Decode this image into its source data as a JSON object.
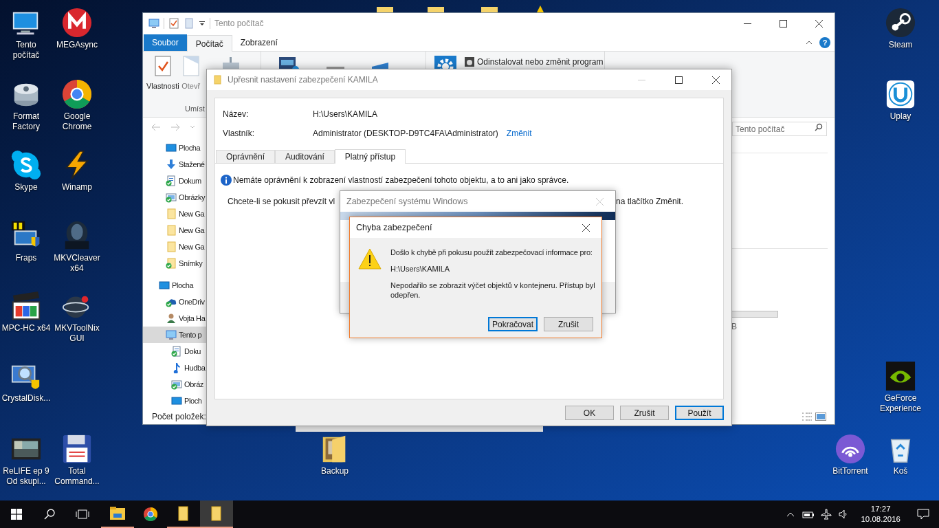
{
  "desktop": {
    "shortcuts": [
      {
        "kind": "computer",
        "lines": [
          "Tento",
          "počítač"
        ]
      },
      {
        "kind": "mega",
        "lines": [
          "MEGAsync"
        ]
      },
      {
        "kind": "format",
        "lines": [
          "Format",
          "Factory"
        ]
      },
      {
        "kind": "chrome",
        "lines": [
          "Google",
          "Chrome"
        ]
      },
      {
        "kind": "skype",
        "lines": [
          "Skype"
        ]
      },
      {
        "kind": "winamp",
        "lines": [
          "Winamp"
        ]
      },
      {
        "kind": "fraps",
        "lines": [
          "Fraps"
        ]
      },
      {
        "kind": "mkvcleaver",
        "lines": [
          "MKVCleaver",
          "x64"
        ]
      },
      {
        "kind": "mpc",
        "lines": [
          "MPC-HC x64"
        ]
      },
      {
        "kind": "mkvtoolnix",
        "lines": [
          "MKVToolNix",
          "GUI"
        ]
      },
      {
        "kind": "crystal",
        "lines": [
          "CrystalDisk..."
        ]
      },
      {
        "kind": "video",
        "lines": [
          "ReLIFE ep 9",
          "Od skupi..."
        ]
      },
      {
        "kind": "totalcmd",
        "lines": [
          "Total",
          "Command..."
        ]
      },
      {
        "kind": "folder_picture",
        "lines": [
          "Backup"
        ]
      },
      {
        "kind": "steam",
        "lines": [
          "Steam"
        ]
      },
      {
        "kind": "uplay",
        "lines": [
          "Uplay"
        ]
      },
      {
        "kind": "geforce",
        "lines": [
          "GeForce",
          "Experience"
        ]
      },
      {
        "kind": "bittorrent",
        "lines": [
          "BitTorrent"
        ]
      },
      {
        "kind": "bin",
        "lines": [
          "Koš"
        ]
      }
    ]
  },
  "explorer": {
    "title": "Tento počítač",
    "tabs": [
      {
        "label": "Soubor",
        "kind": "file",
        "selected": false
      },
      {
        "label": "Počítač",
        "kind": "tab",
        "selected": true
      },
      {
        "label": "Zobrazení",
        "kind": "tab",
        "selected": false
      }
    ],
    "help": "?",
    "ribbon": {
      "items": [
        {
          "label": "Vlastnosti",
          "disabled": false
        },
        {
          "label": "Otevř",
          "disabled": true
        }
      ],
      "group_label": "Umíst",
      "uninstall": "Odinstalovat nebo změnit program"
    },
    "search": {
      "placeholder": "Tento počítač"
    },
    "quick_access": [
      {
        "label": "Plocha",
        "kind": "desktop",
        "synced": false
      },
      {
        "label": "Stažené",
        "kind": "download",
        "synced": false
      },
      {
        "label": "Dokum",
        "kind": "document",
        "synced": true
      },
      {
        "label": "Obrázky",
        "kind": "pictures",
        "synced": true
      },
      {
        "label": "New Ga",
        "kind": "folder",
        "synced": false
      },
      {
        "label": "New Ga",
        "kind": "folder",
        "synced": false
      },
      {
        "label": "New Ga",
        "kind": "folder",
        "synced": false
      },
      {
        "label": "Snímky",
        "kind": "folder",
        "synced": true
      }
    ],
    "tree": [
      {
        "label": "Plocha",
        "kind": "desktop",
        "synced": false,
        "selected": false,
        "children": [
          {
            "label": "OneDriv",
            "kind": "cloud",
            "synced": true,
            "selected": false
          },
          {
            "label": "Vojta Ha",
            "kind": "user",
            "synced": false,
            "selected": false
          },
          {
            "label": "Tento p",
            "kind": "computer",
            "synced": false,
            "selected": true,
            "children": [
              {
                "label": "Doku",
                "kind": "document",
                "synced": true,
                "selected": false
              },
              {
                "label": "Hudba",
                "kind": "music",
                "synced": false,
                "selected": false
              },
              {
                "label": "Obráz",
                "kind": "pictures",
                "synced": true,
                "selected": false
              },
              {
                "label": "Ploch",
                "kind": "desktop",
                "synced": false,
                "selected": false
              }
            ]
          }
        ]
      }
    ],
    "drive_size": "B",
    "status_bar": "Počet položek:"
  },
  "security_dialog": {
    "title": "Upřesnit nastavení zabezpečení KAMILA",
    "fields": [
      {
        "label": "Název:",
        "value": "H:\\Users\\KAMILA"
      },
      {
        "label": "Vlastník:",
        "value": "Administrator (DESKTOP-D9TC4FA\\Administrator)",
        "link": "Změnit"
      }
    ],
    "tabs": [
      {
        "label": "Oprávnění",
        "selected": false
      },
      {
        "label": "Auditování",
        "selected": false
      },
      {
        "label": "Platný přístup",
        "selected": true
      }
    ],
    "info": "Nemáte oprávnění k zobrazení vlastností zabezpečení tohoto objektu, a to ani jako správce.",
    "hint_left": "Chcete-li se pokusit převzít vl",
    "hint_right": "na tlačítko Změnit.",
    "buttons": [
      {
        "label": "OK",
        "default": false
      },
      {
        "label": "Zrušit",
        "default": false
      },
      {
        "label": "Použít",
        "default": true
      }
    ]
  },
  "windows_security": {
    "title": "Zabezpečení systému Windows"
  },
  "error_dialog": {
    "title": "Chyba zabezpečení",
    "message": "Došlo k chybě při pokusu použít zabezpečovací informace pro:",
    "path": "H:\\Users\\KAMILA",
    "detail": "Nepodařilo se zobrazit výčet objektů v kontejneru. Přístup byl odepřen.",
    "buttons": [
      {
        "label": "Pokračovat",
        "default": true
      },
      {
        "label": "Zrušit",
        "default": false
      }
    ]
  },
  "taskbar": {
    "apps": [
      {
        "kind": "explorer",
        "running": true,
        "selected": false
      },
      {
        "kind": "chrome",
        "running": false,
        "selected": false
      },
      {
        "kind": "folder",
        "running": true,
        "selected": false
      },
      {
        "kind": "folder",
        "running": true,
        "selected": true
      }
    ],
    "time": "17:27",
    "date": "10.08.2016"
  }
}
